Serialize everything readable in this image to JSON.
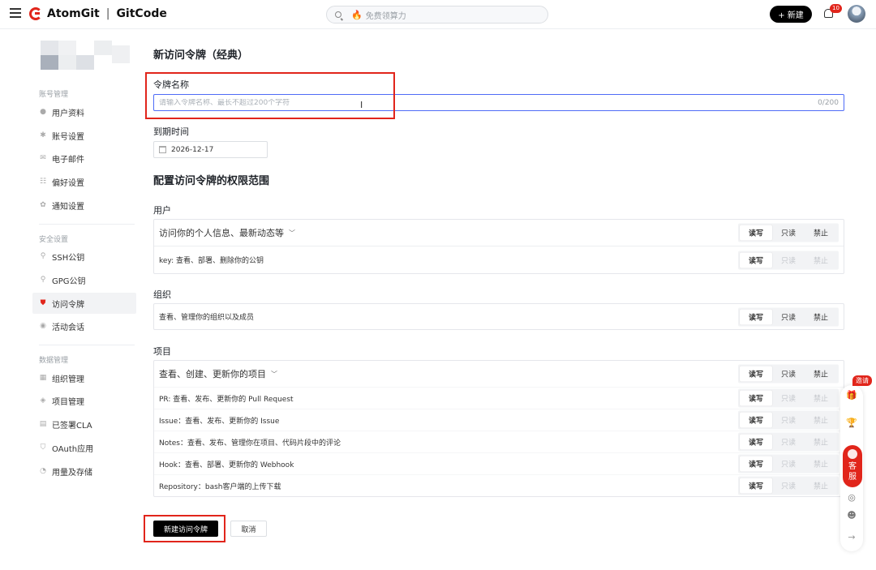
{
  "topbar": {
    "brand": "AtomGit",
    "brand2": "GitCode",
    "brand_sep": "|",
    "search_placeholder": "免费领算力",
    "new_label": "+ 新建",
    "notif_count": "10"
  },
  "sidebar": {
    "groups": [
      {
        "title": "账号管理",
        "items": [
          "用户资料",
          "账号设置",
          "电子邮件",
          "偏好设置",
          "通知设置"
        ]
      },
      {
        "title": "安全设置",
        "items": [
          "SSH公钥",
          "GPG公钥",
          "访问令牌",
          "活动会话"
        ]
      },
      {
        "title": "数据管理",
        "items": [
          "组织管理",
          "项目管理",
          "已签署CLA",
          "OAuth应用",
          "用量及存储"
        ]
      }
    ],
    "active": "访问令牌"
  },
  "form": {
    "title": "新访问令牌（经典）",
    "name_label": "令牌名称",
    "name_placeholder": "请输入令牌名称、最长不超过200个字符",
    "name_counter": "0/200",
    "expire_label": "到期时间",
    "expire_value": "2026-12-17",
    "scope_title": "配置访问令牌的权限范围"
  },
  "options": {
    "read_write": "读写",
    "read_only": "只读",
    "forbid": "禁止"
  },
  "sections": [
    {
      "label": "用户",
      "head": "访问你的个人信息、最新动态等",
      "rows": [
        {
          "text": "key:  查看、部署、删除你的公钥",
          "disabled": true
        }
      ]
    },
    {
      "label": "组织",
      "head": null,
      "rows": [
        {
          "text": "查看、管理你的组织以及成员",
          "disabled": false
        }
      ]
    },
    {
      "label": "项目",
      "head": "查看、创建、更新你的项目",
      "rows": [
        {
          "text": "PR:  查看、发布、更新你的 Pull Request",
          "disabled": true
        },
        {
          "text": "Issue：查看、发布、更新你的 Issue",
          "disabled": true
        },
        {
          "text": "Notes：查看、发布、管理你在项目、代码片段中的评论",
          "disabled": true
        },
        {
          "text": "Hook：查看、部署、更新你的 Webhook",
          "disabled": true
        },
        {
          "text": "Repository：bash客户端的上传下载",
          "disabled": true
        }
      ]
    }
  ],
  "actions": {
    "create": "新建访问令牌",
    "cancel": "取消"
  },
  "float": {
    "invite": "邀请",
    "service": "客\n服"
  },
  "colors": {
    "accent_red": "#e1251b",
    "focus_blue": "#4f6cf7"
  }
}
